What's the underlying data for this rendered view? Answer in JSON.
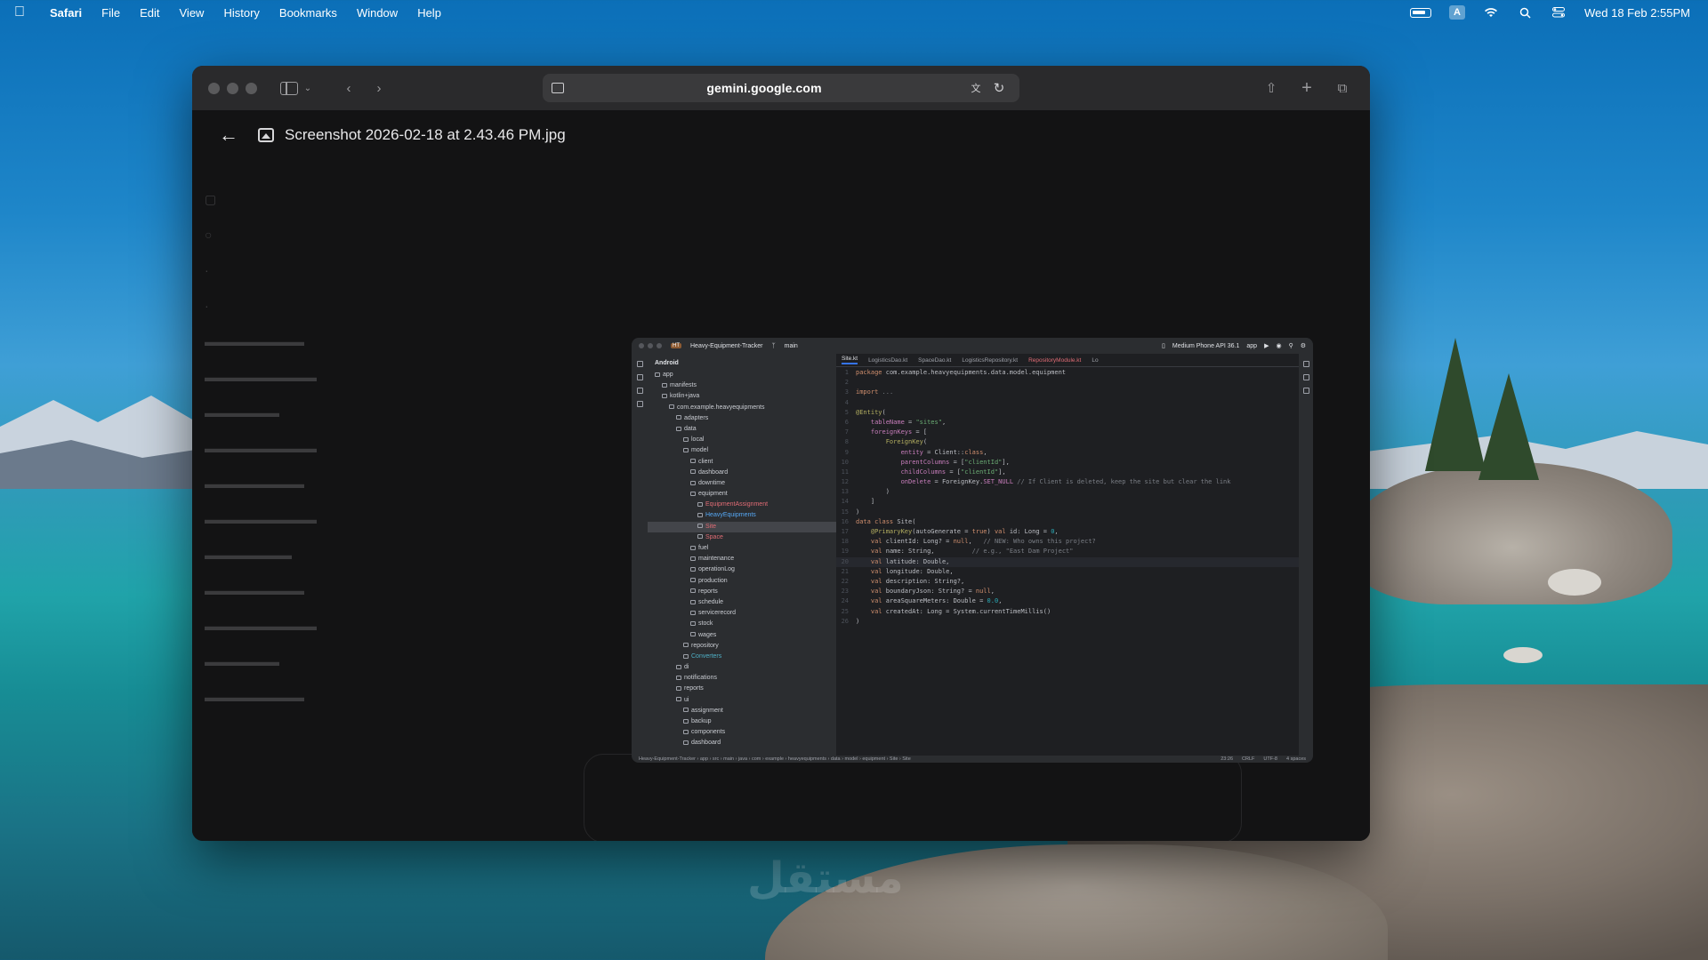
{
  "menubar": {
    "app_name": "Safari",
    "items": [
      "File",
      "Edit",
      "View",
      "History",
      "Bookmarks",
      "Window",
      "Help"
    ],
    "clock": "Wed 18 Feb  2:55PM",
    "input_source": "A"
  },
  "browser": {
    "url": "gemini.google.com"
  },
  "viewer": {
    "filename": "Screenshot 2026-02-18 at 2.43.46 PM.jpg"
  },
  "ide": {
    "project": "Heavy-Equipment-Tracker",
    "project_badge": "HT",
    "branch": "main",
    "device": "Medium Phone API 36.1",
    "run_config": "app",
    "tree_header": "Android",
    "tabs": [
      "Site.kt",
      "LogisticsDao.kt",
      "SpaceDao.kt",
      "LogisticsRepository.kt",
      "RepositoryModule.kt",
      "Lo"
    ],
    "tree": [
      {
        "label": "app",
        "indent": 1
      },
      {
        "label": "manifests",
        "indent": 2
      },
      {
        "label": "kotlin+java",
        "indent": 2
      },
      {
        "label": "com.example.heavyequipments",
        "indent": 3
      },
      {
        "label": "adapters",
        "indent": 4
      },
      {
        "label": "data",
        "indent": 4
      },
      {
        "label": "local",
        "indent": 5
      },
      {
        "label": "model",
        "indent": 5
      },
      {
        "label": "client",
        "indent": 6
      },
      {
        "label": "dashboard",
        "indent": 6
      },
      {
        "label": "downtime",
        "indent": 6
      },
      {
        "label": "equipment",
        "indent": 6
      },
      {
        "label": "EquipmentAssignment",
        "indent": 7,
        "style": "red"
      },
      {
        "label": "HeavyEquipments",
        "indent": 7,
        "style": "blue"
      },
      {
        "label": "Site",
        "indent": 7,
        "style": "red sel"
      },
      {
        "label": "Space",
        "indent": 7,
        "style": "red"
      },
      {
        "label": "fuel",
        "indent": 6
      },
      {
        "label": "maintenance",
        "indent": 6
      },
      {
        "label": "operationLog",
        "indent": 6
      },
      {
        "label": "production",
        "indent": 6
      },
      {
        "label": "reports",
        "indent": 6
      },
      {
        "label": "schedule",
        "indent": 6
      },
      {
        "label": "servicerecord",
        "indent": 6
      },
      {
        "label": "stock",
        "indent": 6
      },
      {
        "label": "wages",
        "indent": 6
      },
      {
        "label": "repository",
        "indent": 5
      },
      {
        "label": "Converters",
        "indent": 5,
        "style": "teal"
      },
      {
        "label": "di",
        "indent": 4
      },
      {
        "label": "notifications",
        "indent": 4
      },
      {
        "label": "reports",
        "indent": 4
      },
      {
        "label": "ui",
        "indent": 4
      },
      {
        "label": "assignment",
        "indent": 5
      },
      {
        "label": "backup",
        "indent": 5
      },
      {
        "label": "components",
        "indent": 5
      },
      {
        "label": "dashboard",
        "indent": 5
      }
    ],
    "code": [
      {
        "n": "1",
        "html": "<span class='kw'>package</span> com.example.heavyequipments.data.model.equipment"
      },
      {
        "n": "2",
        "html": ""
      },
      {
        "n": "3",
        "html": "<span class='kw'>import</span> <span class='cm'>...</span>"
      },
      {
        "n": "4",
        "html": ""
      },
      {
        "n": "5",
        "html": "<span class='ann'>@Entity</span>("
      },
      {
        "n": "6",
        "html": "    <span class='prop'>tableName</span> = <span class='str'>\"sites\"</span>,"
      },
      {
        "n": "7",
        "html": "    <span class='prop'>foreignKeys</span> = ["
      },
      {
        "n": "8",
        "html": "        <span class='ann'>ForeignKey</span>("
      },
      {
        "n": "9",
        "html": "            <span class='prop'>entity</span> = Client::<span class='kw'>class</span>,"
      },
      {
        "n": "10",
        "html": "            <span class='prop'>parentColumns</span> = [<span class='str'>\"clientId\"</span>],"
      },
      {
        "n": "11",
        "html": "            <span class='prop'>childColumns</span> = [<span class='str'>\"clientId\"</span>],"
      },
      {
        "n": "12",
        "html": "            <span class='prop'>onDelete</span> = ForeignKey.<span class='prop'>SET_NULL</span> <span class='cm'>// If Client is deleted, keep the site but clear the link</span>"
      },
      {
        "n": "13",
        "html": "        )"
      },
      {
        "n": "14",
        "html": "    ]"
      },
      {
        "n": "15",
        "html": ")"
      },
      {
        "n": "16",
        "html": "<span class='kw'>data class</span> Site("
      },
      {
        "n": "17",
        "html": "    <span class='ann'>@PrimaryKey</span>(autoGenerate = <span class='kw'>true</span>) <span class='kw'>val</span> id: Long = <span class='num'>0</span>,"
      },
      {
        "n": "18",
        "html": "    <span class='kw'>val</span> clientId: Long? = <span class='kw'>null</span>,   <span class='cm'>// NEW: Who owns this project?</span>"
      },
      {
        "n": "19",
        "html": "    <span class='kw'>val</span> name: String,          <span class='cm'>// e.g., \"East Dam Project\"</span>"
      },
      {
        "n": "20",
        "html": "    <span class='kw'>val</span> latitude: Double,",
        "cur": true
      },
      {
        "n": "21",
        "html": "    <span class='kw'>val</span> longitude: Double,"
      },
      {
        "n": "22",
        "html": "    <span class='kw'>val</span> description: String?,"
      },
      {
        "n": "23",
        "html": "    <span class='kw'>val</span> boundaryJson: String? = <span class='kw'>null</span>,"
      },
      {
        "n": "24",
        "html": "    <span class='kw'>val</span> areaSquareMeters: Double = <span class='num'>0.0</span>,"
      },
      {
        "n": "25",
        "html": "    <span class='kw'>val</span> createdAt: Long = System.currentTimeMillis()"
      },
      {
        "n": "26",
        "html": ")"
      }
    ],
    "status_path": "Heavy-Equipment-Tracker › app › src › main › java › com › example › heavyequipments › data › model › equipment › Site › Site",
    "status_pos": "23:26",
    "status_eol": "CRLF",
    "status_enc": "UTF-8",
    "status_indent": "4 spaces"
  },
  "watermark": "مستقل"
}
